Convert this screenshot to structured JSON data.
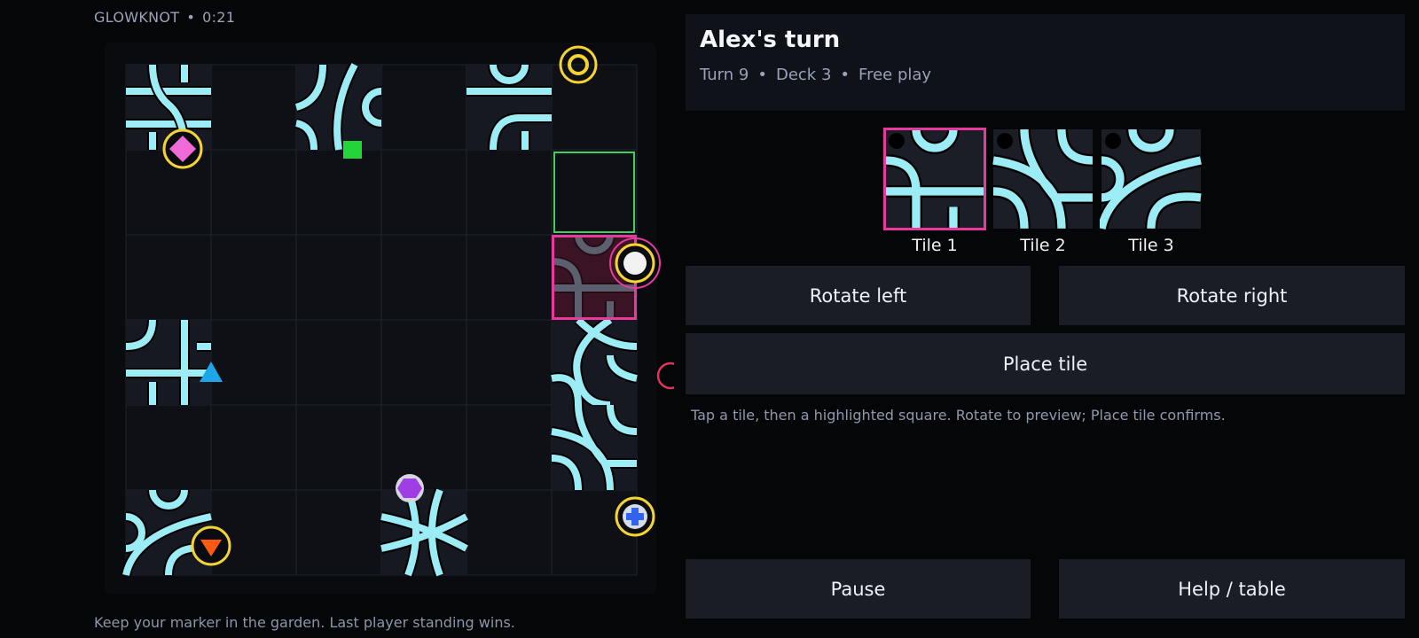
{
  "header": {
    "title": "GLOWKNOT",
    "separator": "•",
    "timer": "0:21"
  },
  "footer_tip": "Keep your marker in the garden. Last player standing wins.",
  "turn": {
    "title": "Alex's turn",
    "meta": [
      "Turn 9",
      "Deck 3",
      "Free play"
    ],
    "separator": "•"
  },
  "hand": {
    "tiles": [
      {
        "label": "Tile 1",
        "selected": true
      },
      {
        "label": "Tile 2",
        "selected": false
      },
      {
        "label": "Tile 3",
        "selected": false
      }
    ]
  },
  "buttons": {
    "rotate_left": "Rotate left",
    "rotate_right": "Rotate right",
    "place": "Place tile",
    "pause": "Pause",
    "help": "Help / table"
  },
  "hint": "Tap a tile, then a highlighted square. Rotate to preview; Place tile confirms.",
  "board": {
    "rows": 6,
    "cols": 6,
    "placed_tiles": [
      [
        0,
        0
      ],
      [
        0,
        2
      ],
      [
        0,
        4
      ],
      [
        3,
        0
      ],
      [
        3,
        5
      ],
      [
        4,
        5
      ],
      [
        5,
        0
      ],
      [
        5,
        3
      ]
    ],
    "highlighted_square": [
      1,
      5
    ],
    "preview_square": [
      2,
      5
    ],
    "markers": [
      {
        "name": "pink-diamond-marker",
        "color": "#f06ad8"
      },
      {
        "name": "green-square-marker",
        "color": "#22d63a"
      },
      {
        "name": "cyan-triangle-marker",
        "color": "#1ea7e8"
      },
      {
        "name": "purple-hexagon-marker",
        "color": "#a03ee6"
      },
      {
        "name": "orange-triangle-marker",
        "color": "#ff5a12"
      },
      {
        "name": "blue-cross-marker",
        "color": "#2f63f0"
      },
      {
        "name": "white-circle-marker",
        "color": "#f2f2f2"
      },
      {
        "name": "yellow-ring-marker",
        "color": "#f5d431"
      }
    ]
  },
  "colors": {
    "path": "#9cecf5",
    "highlight_green": "#3ecf5e",
    "selection_pink": "#e83a9c",
    "entry_ring": "#e2335f"
  }
}
